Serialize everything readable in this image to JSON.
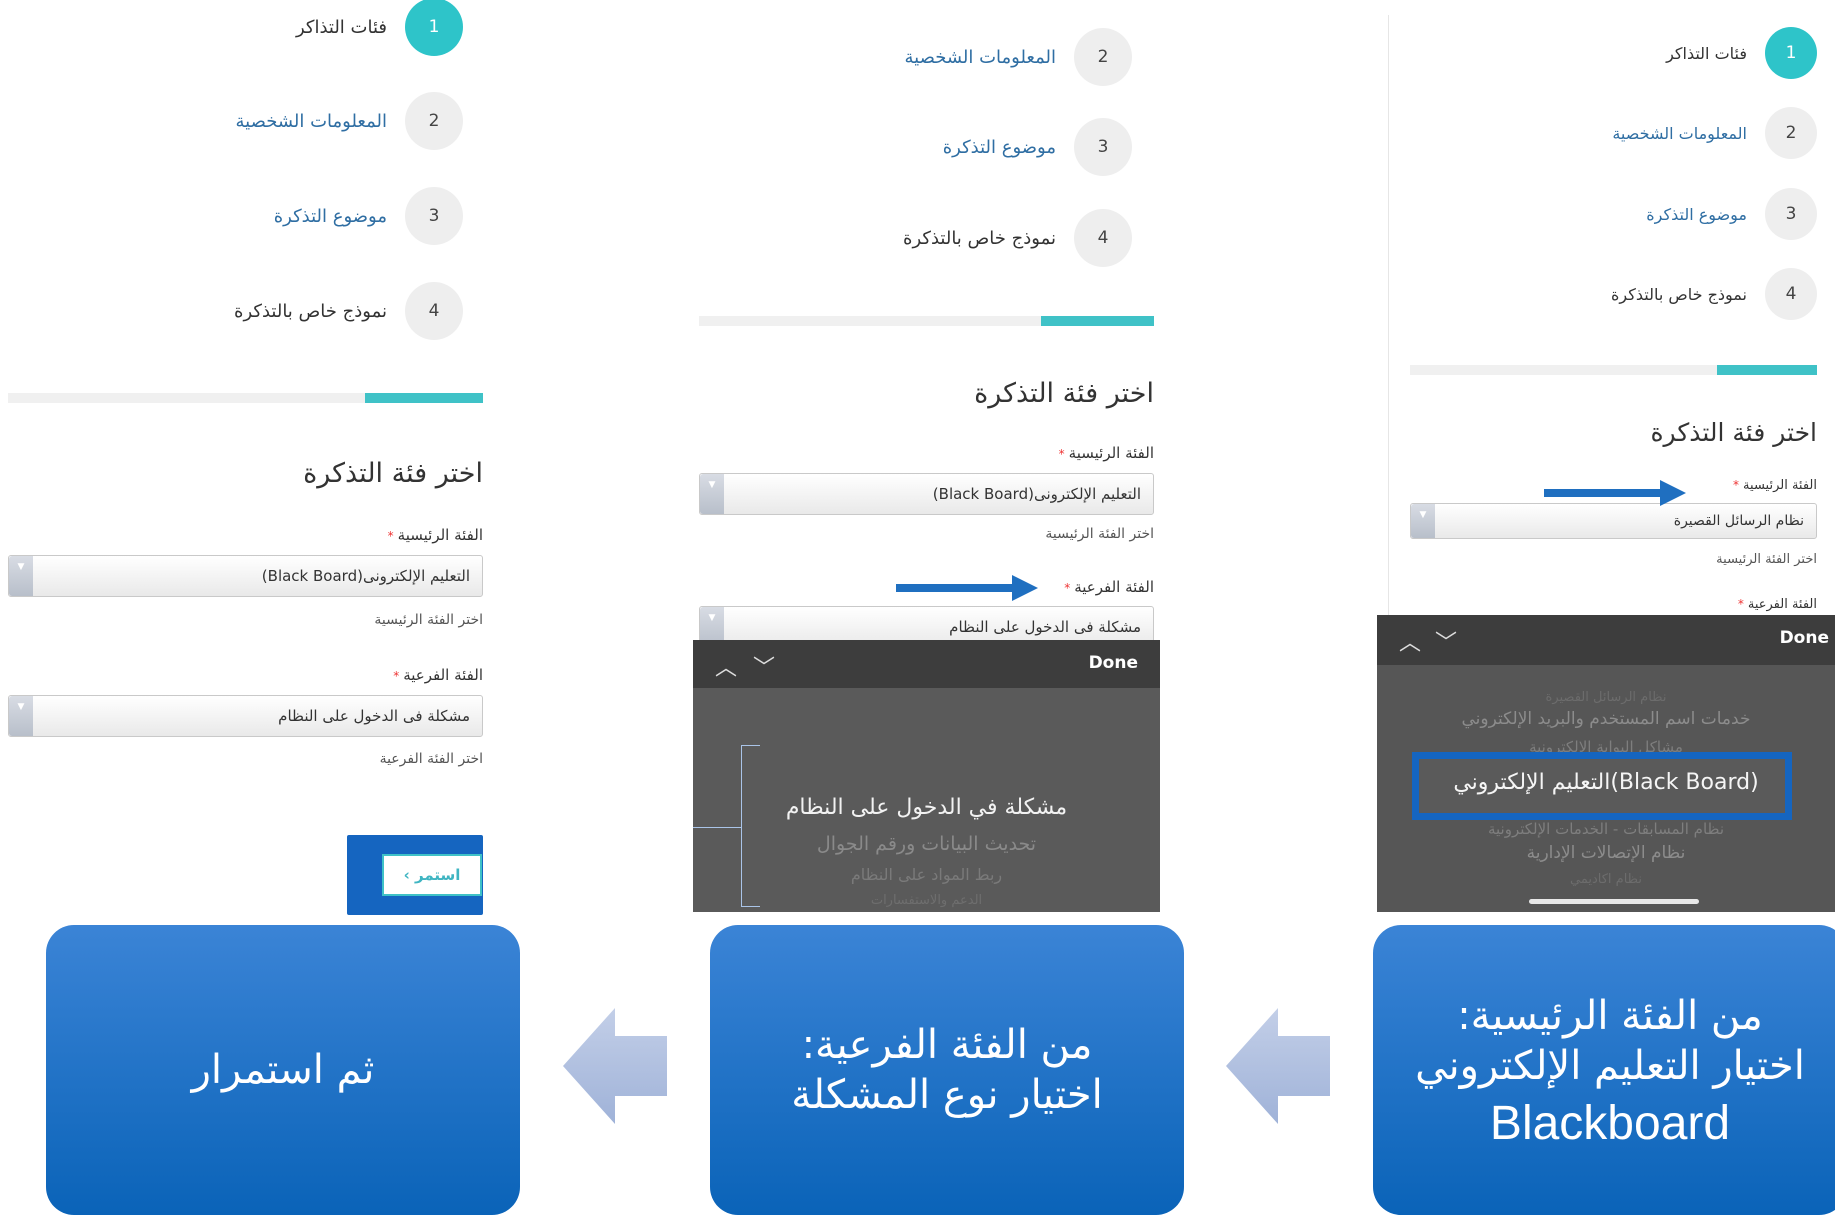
{
  "steps": [
    {
      "num": "1",
      "label": "فئات التذاكر"
    },
    {
      "num": "2",
      "label": "المعلومات الشخصية"
    },
    {
      "num": "3",
      "label": "موضوع التذكرة"
    },
    {
      "num": "4",
      "label": "نموذج خاص بالتذكرة"
    }
  ],
  "form": {
    "title": "اختر فئة التذكرة",
    "main_label": "الفئة الرئيسية",
    "sub_label": "الفئة الفرعية",
    "required_mark": "*",
    "main_hint": "اختر الفئة الرئيسية",
    "sub_hint": "اختر الفئة الفرعية",
    "continue_label": "استمر ›"
  },
  "panel_left": {
    "main_value": "التعليم الإلكترونى(Black Board)",
    "sub_value": "مشكلة فى الدخول على النظام"
  },
  "panel_middle": {
    "main_value": "التعليم الإلكترونى(Black Board)",
    "sub_value": "مشكلة فى الدخول على النظام",
    "picker": {
      "done": "Done",
      "options": [
        "مشكلة في الدخول على النظام",
        "تحديث البيانات ورقم الجوال",
        "ربط المواد على النظام",
        "الدعم والاستفسارات"
      ]
    }
  },
  "panel_right": {
    "main_value": "نظام الرسائل القصيرة",
    "picker": {
      "done": "Done",
      "options": [
        "نظام الرسائل القصيرة",
        "خدمات اسم المستخدم والبريد الإلكتروني",
        "مشاكل البوابة الإلكترونية",
        "التعليم الإلكتروني(Black Board)",
        "نظام المسابقات - الخدمات الإلكترونية",
        "نظام الإتصالات الإدارية",
        "نظام اكاديمي"
      ]
    }
  },
  "captions": {
    "right": [
      "من الفئة الرئيسية:",
      "اختيار التعليم الإلكتروني",
      "Blackboard"
    ],
    "middle": [
      "من الفئة الفرعية:",
      "اختيار نوع المشكلة"
    ],
    "left": [
      "ثم استمرار"
    ]
  },
  "colors": {
    "teal": "#2ec4c9",
    "link": "#2f6ea3",
    "highlight": "#1f6fc0",
    "box": "#0a63b8"
  }
}
